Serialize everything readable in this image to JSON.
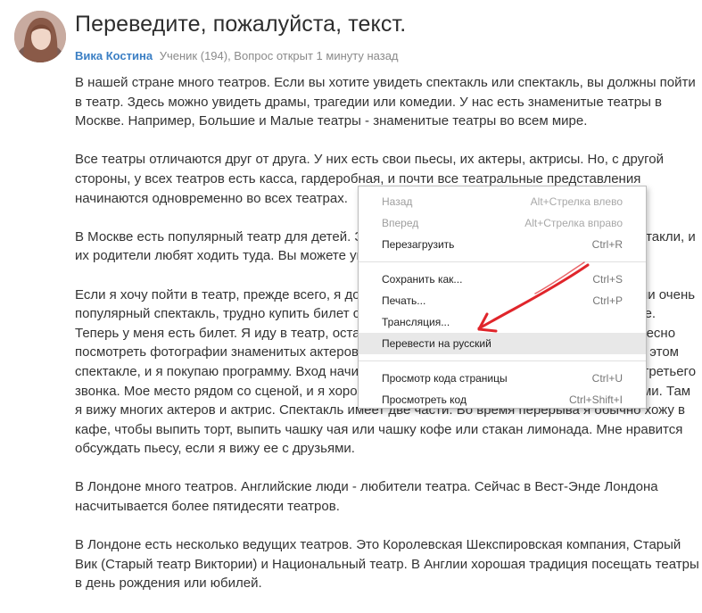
{
  "question": {
    "title": "Переведите, пожалуйста, текст.",
    "author": "Вика Костина",
    "meta": "Ученик (194), Вопрос открыт 1 минуту назад"
  },
  "body": {
    "paragraphs": [
      "В нашей стране много театров. Если вы хотите увидеть спектакль или спектакль, вы должны пойти в театр. Здесь можно увидеть драмы, трагедии или комедии. У нас есть знаменитые театры в Москве. Например, Большие и Малые театры - знаменитые театры во всем мире.",
      "Все театры отличаются друг от друга. У них есть свои пьесы, их актеры, актрисы. Но, с другой стороны, у всех театров есть касса, гардеробная, и почти все театральные представления начинаются одновременно во всех театрах.",
      "В Москве есть популярный театр для детей. Здесь дети могут посмотреть интересные спектакли, и их родители любят ходить туда. Вы можете увидеть там разные спектакли.",
      "Если я хочу пойти в театр, прежде всего, я должен купить билет в кассе. Если это новый или очень популярный спектакль, трудно купить билет сразу, поэтому я стараюсь заказать его заранее. Теперь у меня есть билет. Я иду в театр, оставляю пальто в гардеробе и иду в фойе. Интересно посмотреть фотографии знаменитых актеров и актрис на стенах. Я хочу знать, кто играет в этом спектакле, и я покупаю программу. Вход начинается после второго звонка, а вечера после третьего звонка. Мое место рядом со сценой, и я хорошо вижу, хлопаю и аплодирую вместе с другими. Там я вижу многих актеров и актрис. Спектакль имеет две части. Во время перерыва я обычно хожу в кафе, чтобы выпить торт, выпить чашку чая или чашку кофе или стакан лимонада. Мне нравится обсуждать пьесу, если я вижу ее с друзьями.",
      "В Лондоне много театров. Английские люди - любители театра. Сейчас в Вест-Энде Лондона насчитывается более пятидесяти театров.",
      "В Лондоне есть несколько ведущих театров. Это Королевская Шекспировская компания, Старый Вик (Старый театр Виктории) и Национальный театр. В Англии хорошая традиция посещать театры в день рождения или юбилей."
    ]
  },
  "context_menu": {
    "back": {
      "label": "Назад",
      "shortcut": "Alt+Стрелка влево"
    },
    "forward": {
      "label": "Вперед",
      "shortcut": "Alt+Стрелка вправо"
    },
    "reload": {
      "label": "Перезагрузить",
      "shortcut": "Ctrl+R"
    },
    "save_as": {
      "label": "Сохранить как...",
      "shortcut": "Ctrl+S"
    },
    "print": {
      "label": "Печать...",
      "shortcut": "Ctrl+P"
    },
    "cast": {
      "label": "Трансляция...",
      "shortcut": ""
    },
    "translate": {
      "label": "Перевести на русский",
      "shortcut": ""
    },
    "view_source": {
      "label": "Просмотр кода страницы",
      "shortcut": "Ctrl+U"
    },
    "inspect": {
      "label": "Просмотреть код",
      "shortcut": "Ctrl+Shift+I"
    }
  },
  "colors": {
    "author_link": "#3b7fc4",
    "annotation_arrow": "#e0252b",
    "menu_highlight": "#e8e8e8"
  },
  "icons": {
    "annotation": "red-arrow-icon"
  }
}
